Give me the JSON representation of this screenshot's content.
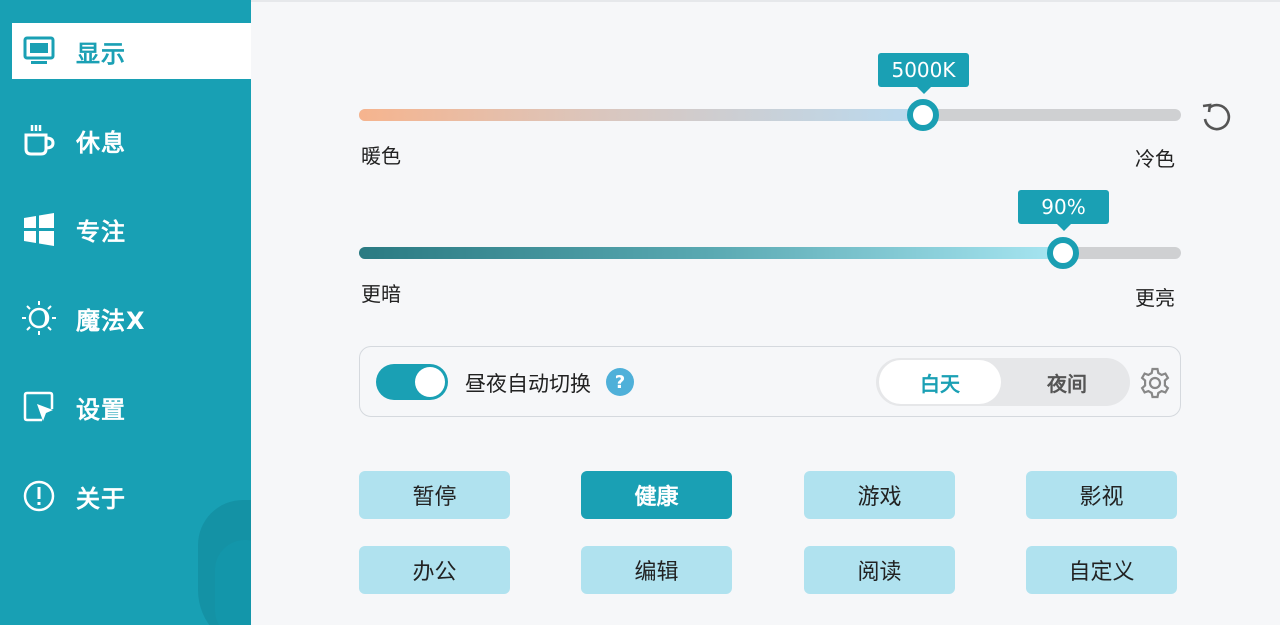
{
  "sidebar": {
    "items": [
      {
        "label": "显示",
        "icon": "monitor-icon",
        "active": true
      },
      {
        "label": "休息",
        "icon": "coffee-cup-icon",
        "active": false
      },
      {
        "label": "专注",
        "icon": "windows-logo-icon",
        "active": false
      },
      {
        "label": "魔法X",
        "icon": "sun-moon-icon",
        "active": false
      },
      {
        "label": "设置",
        "icon": "cursor-window-icon",
        "active": false
      },
      {
        "label": "关于",
        "icon": "info-icon",
        "active": false
      }
    ]
  },
  "color_temp": {
    "value_label": "5000K",
    "fraction": 0.686,
    "min_label": "暖色",
    "max_label": "冷色"
  },
  "brightness": {
    "value_label": "90%",
    "fraction": 0.857,
    "min_label": "更暗",
    "max_label": "更亮"
  },
  "auto_switch": {
    "enabled": true,
    "label": "昼夜自动切换",
    "help": "?",
    "day_label": "白天",
    "night_label": "夜间",
    "selected": "白天"
  },
  "modes": [
    {
      "label": "暂停",
      "active": false
    },
    {
      "label": "健康",
      "active": true
    },
    {
      "label": "游戏",
      "active": false
    },
    {
      "label": "影视",
      "active": false
    },
    {
      "label": "办公",
      "active": false
    },
    {
      "label": "编辑",
      "active": false
    },
    {
      "label": "阅读",
      "active": false
    },
    {
      "label": "自定义",
      "active": false
    }
  ],
  "colors": {
    "accent": "#1aa0b4",
    "sidebar": "#18a0b4",
    "mode_button": "#b0e2ef"
  }
}
